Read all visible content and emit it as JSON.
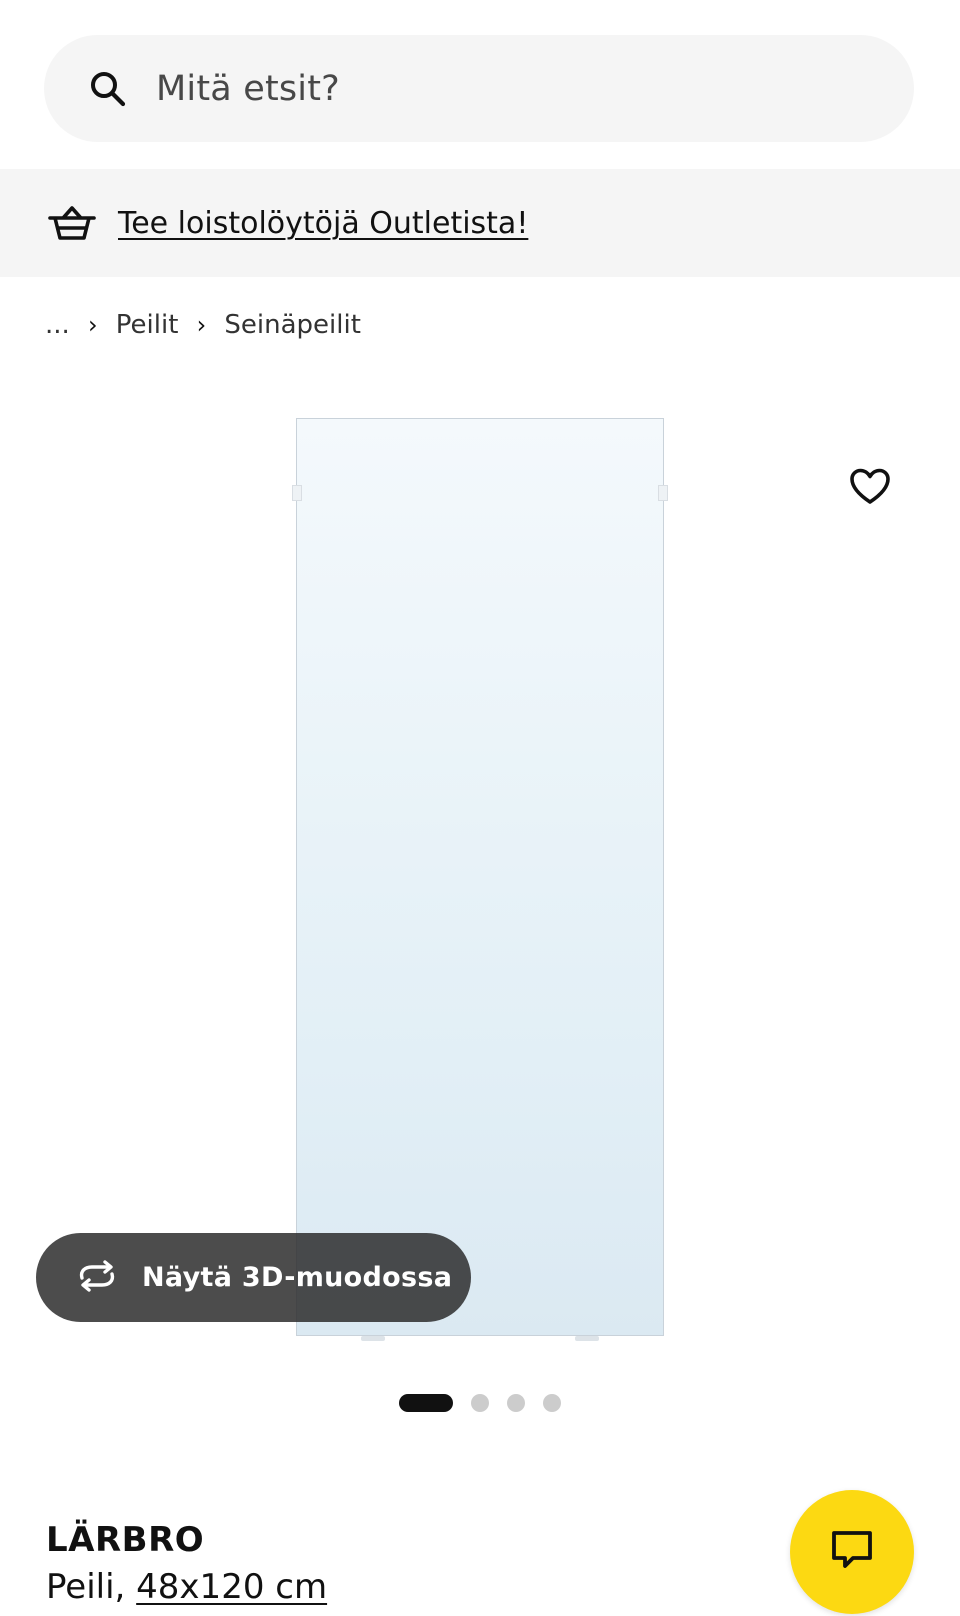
{
  "search": {
    "placeholder": "Mitä etsit?",
    "icon": "search-icon"
  },
  "banner": {
    "icon": "outlet-basket-icon",
    "link_text": "Tee loistolöytöjä Outletista!"
  },
  "breadcrumb": {
    "items": [
      "...",
      "Peilit",
      "Seinäpeilit"
    ],
    "separator_icon": "chevron-right-icon"
  },
  "product_image": {
    "favourite_icon": "heart-icon",
    "view_3d": {
      "icon": "rotate-3d-icon",
      "label": "Näytä 3D-muodossa"
    },
    "carousel": {
      "total": 4,
      "active_index": 0
    }
  },
  "product": {
    "name": "LÄRBRO",
    "type": "Peili,",
    "size": "48x120 cm"
  },
  "chat": {
    "icon": "chat-icon"
  },
  "colors": {
    "accent_yellow": "#fcd912",
    "surface_gray": "#f5f5f5",
    "text": "#111111"
  }
}
